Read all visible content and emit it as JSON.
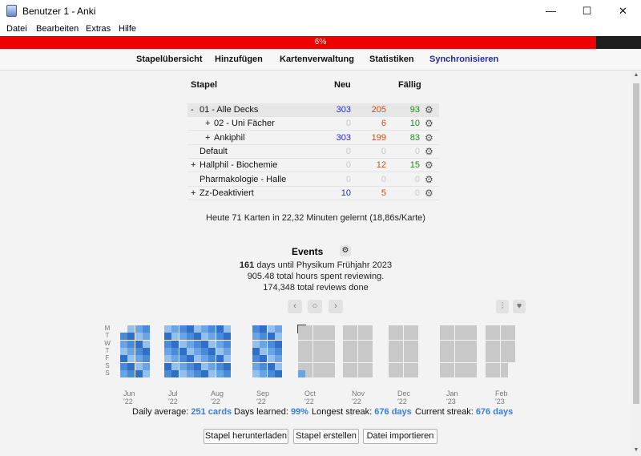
{
  "window": {
    "title": "Benutzer 1 - Anki",
    "minimize": "—",
    "maximize": "☐",
    "close": "✕"
  },
  "menu": {
    "file": "Datei",
    "edit": "Bearbeiten",
    "extras": "Extras",
    "help": "Hilfe"
  },
  "sync_progress": {
    "label": "6%",
    "fraction": 0.93
  },
  "toolbar": {
    "decks": "Stapelübersicht",
    "add": "Hinzufügen",
    "browse": "Kartenverwaltung",
    "stats": "Statistiken",
    "sync": "Synchronisieren"
  },
  "deck_table": {
    "col_deck": "Stapel",
    "col_new": "Neu",
    "col_due": "Fällig",
    "rows": [
      {
        "toggle": "-",
        "name": "01 - Alle Decks",
        "new": "303",
        "learn": "205",
        "due": "93",
        "current": true,
        "indent": 0
      },
      {
        "toggle": "+",
        "name": "02 - Uni Fächer",
        "new": "0",
        "learn": "6",
        "due": "10",
        "current": false,
        "indent": 1
      },
      {
        "toggle": "+",
        "name": "Ankiphil",
        "new": "303",
        "learn": "199",
        "due": "83",
        "current": false,
        "indent": 1
      },
      {
        "toggle": "",
        "name": "Default",
        "new": "0",
        "learn": "0",
        "due": "0",
        "current": false,
        "indent": 0
      },
      {
        "toggle": "+",
        "name": "Hallphil - Biochemie",
        "new": "0",
        "learn": "12",
        "due": "15",
        "current": false,
        "indent": 0
      },
      {
        "toggle": "",
        "name": "Pharmakologie - Halle",
        "new": "0",
        "learn": "0",
        "due": "0",
        "current": false,
        "indent": 0
      },
      {
        "toggle": "+",
        "name": "Zz-Deaktiviert",
        "new": "10",
        "learn": "5",
        "due": "0",
        "current": false,
        "indent": 0
      }
    ]
  },
  "studied_today": "Heute 71 Karten in 22,32 Minuten gelernt (18,86s/Karte)",
  "events": {
    "title": "Events",
    "line1_bold": "161",
    "line1_rest": " days until Physikum Frühjahr 2023",
    "line2": "905.48 total hours spent reviewing.",
    "line3": "174,348 total reviews done"
  },
  "heatmap": {
    "day_labels": [
      "M",
      "T",
      "W",
      "T",
      "F",
      "S",
      "S"
    ],
    "month_labels": [
      "Jun '22",
      "Jul '22",
      "Aug '22",
      "Sep '22",
      "Oct '22",
      "Nov '22",
      "Dec '22",
      "Jan '23",
      "Feb '23"
    ],
    "colors": {
      "past": [
        "#2f6fc8",
        "#4a8ad8",
        "#6aa4e4",
        "#94c0ee"
      ],
      "future": "#c8c8c8"
    }
  },
  "stats": {
    "daily_label": "Daily average:",
    "daily_value": "251 cards",
    "learned_label": "Days learned:",
    "learned_value": "99%",
    "longest_label": "Longest streak:",
    "longest_value": "676 days",
    "current_label": "Current streak:",
    "current_value": "676 days"
  },
  "buttons": {
    "download": "Stapel herunterladen",
    "create": "Stapel erstellen",
    "import": "Datei importieren"
  }
}
